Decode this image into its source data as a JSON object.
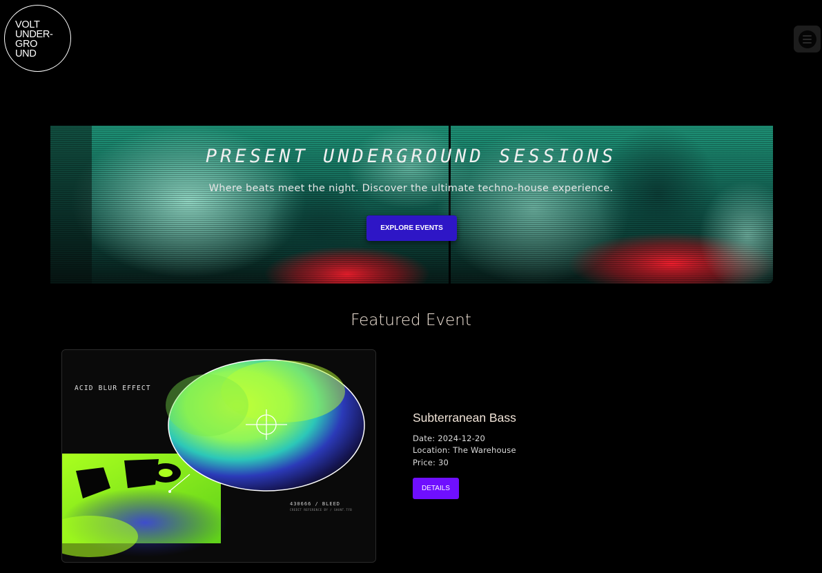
{
  "logo": {
    "lines": [
      "VOLT",
      "UNDER-",
      "GRO",
      "UND"
    ]
  },
  "header": {
    "menu_icon": "hamburger-menu-icon"
  },
  "hero": {
    "title": "PRESENT UNDERGROUND SESSIONS",
    "subtitle": "Where beats meet the night. Discover the ultimate techno-house experience.",
    "button_label": "EXPLORE EVENTS"
  },
  "featured": {
    "heading": "Featured Event",
    "artwork": {
      "label": "ACID BLUR EFFECT",
      "code": "430666 / BLEED",
      "credit": "CREDIT REFERENCE BY / SHUNT.TFB"
    },
    "event": {
      "name": "Subterranean Bass",
      "date": "Date: 2024-12-20",
      "location": "Location: The Warehouse",
      "price": "Price: 30",
      "button_label": "DETAILS"
    }
  },
  "colors": {
    "background": "#000000",
    "hero_button": "#2e16c6",
    "details_button": "#6f0fff",
    "heading": "#f1e4d8"
  }
}
